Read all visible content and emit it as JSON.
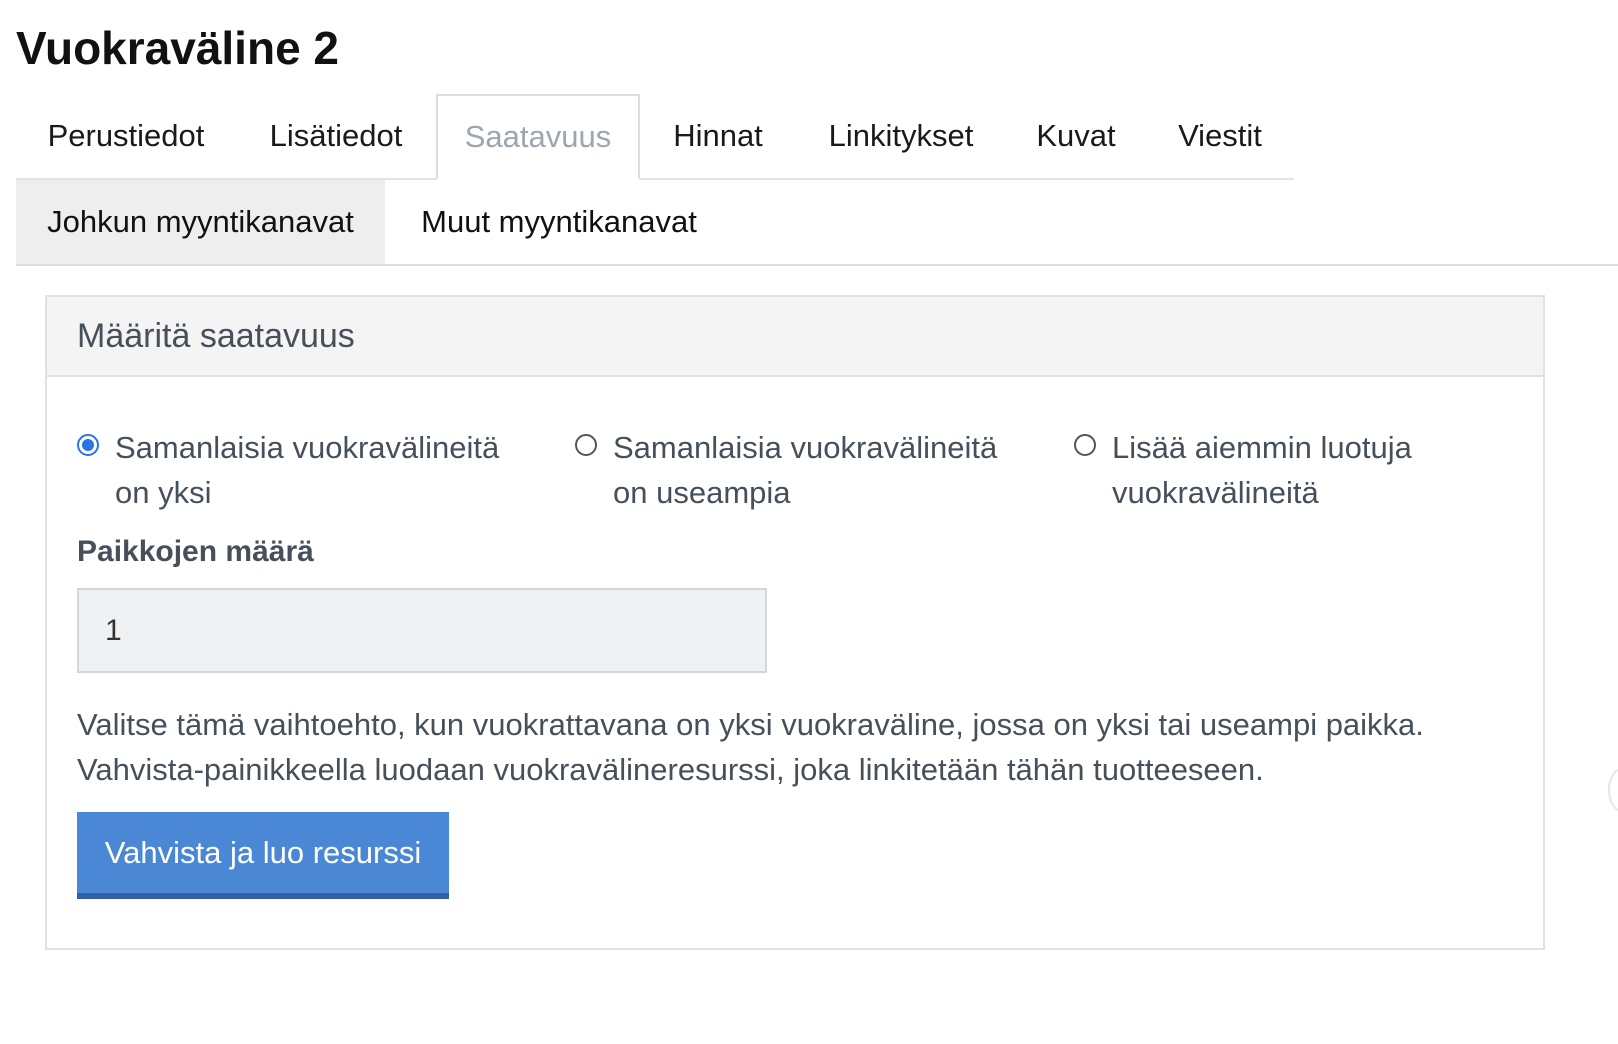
{
  "page": {
    "title": "Vuokraväline 2"
  },
  "main_tabs": [
    {
      "label": "Perustiedot",
      "active": false
    },
    {
      "label": "Lisätiedot",
      "active": false
    },
    {
      "label": "Saatavuus",
      "active": true
    },
    {
      "label": "Hinnat",
      "active": false
    },
    {
      "label": "Linkitykset",
      "active": false
    },
    {
      "label": "Kuvat",
      "active": false
    },
    {
      "label": "Viestit",
      "active": false
    }
  ],
  "sub_tabs": [
    {
      "label": "Johkun myyntikanavat",
      "active": true
    },
    {
      "label": "Muut myyntikanavat",
      "active": false
    }
  ],
  "panel": {
    "title": "Määritä saatavuus",
    "options": [
      {
        "label": "Samanlaisia vuokravälineitä on yksi",
        "checked": true
      },
      {
        "label": "Samanlaisia vuokravälineitä on useampia",
        "checked": false
      },
      {
        "label": "Lisää aiemmin luotuja vuokravälineitä",
        "checked": false
      }
    ],
    "field_label": "Paikkojen määrä",
    "field_value": "1",
    "help_text": "Valitse tämä vaihtoehto, kun vuokrattavana on yksi vuokraväline, jossa on yksi tai useampi paikka. Vahvista-painikkeella luodaan vuokravälineresurssi, joka linkitetään tähän tuotteeseen.",
    "button_label": "Vahvista ja luo resurssi"
  },
  "colors": {
    "accent": "#2a73e8",
    "button": "#4a88d6",
    "muted_text": "#46505a"
  }
}
